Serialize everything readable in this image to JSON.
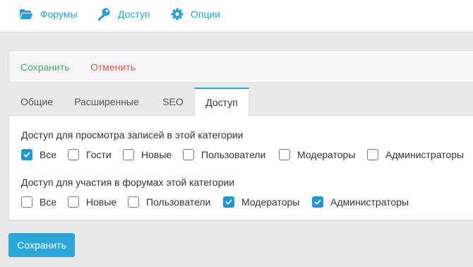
{
  "nav": {
    "forums_label": "Форумы",
    "access_label": "Доступ",
    "options_label": "Опции"
  },
  "actions": {
    "save_label": "Сохранить",
    "cancel_label": "Отменить"
  },
  "tabs": [
    {
      "label": "Общие",
      "active": false
    },
    {
      "label": "Расширенные",
      "active": false
    },
    {
      "label": "SEO",
      "active": false
    },
    {
      "label": "Доступ",
      "active": true
    }
  ],
  "view_group": {
    "title": "Доступ для просмотра записей в этой категории",
    "options": [
      {
        "label": "Все",
        "checked": true
      },
      {
        "label": "Гости",
        "checked": false
      },
      {
        "label": "Новые",
        "checked": false
      },
      {
        "label": "Пользователи",
        "checked": false
      },
      {
        "label": "Модераторы",
        "checked": false
      },
      {
        "label": "Администраторы",
        "checked": false
      }
    ]
  },
  "participate_group": {
    "title": "Доступ для участия в форумах этой категории",
    "options": [
      {
        "label": "Все",
        "checked": false
      },
      {
        "label": "Новые",
        "checked": false
      },
      {
        "label": "Пользователи",
        "checked": false
      },
      {
        "label": "Модераторы",
        "checked": true
      },
      {
        "label": "Администраторы",
        "checked": true
      }
    ]
  },
  "footer": {
    "save_label": "Сохранить"
  },
  "colors": {
    "accent": "#2aa7d8",
    "link": "#2a9fd6",
    "save_text": "#43b05c",
    "cancel_text": "#e0514c",
    "checkbox_checked": "#2196d3"
  },
  "icons": {
    "forums": "folder-open-icon",
    "access": "key-icon",
    "options": "gear-icon"
  }
}
